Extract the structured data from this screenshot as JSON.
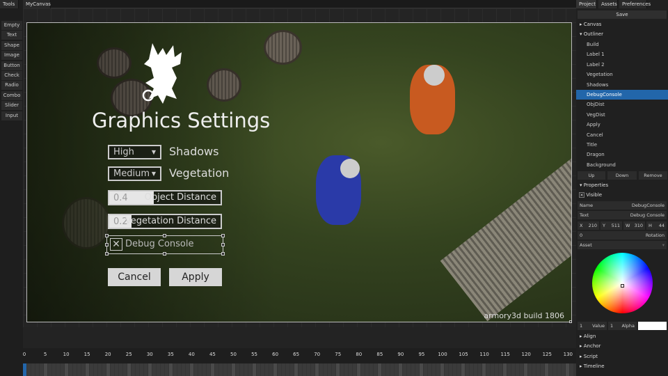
{
  "tabs": {
    "tools": "Tools",
    "canvas": "MyCanvas"
  },
  "tools": [
    "Empty",
    "Text",
    "Shape",
    "Image",
    "Button",
    "Check",
    "Radio",
    "Combo",
    "Slider",
    "Input"
  ],
  "scene": {
    "title": "Graphics Settings",
    "shadows": {
      "value": "High",
      "label": "Shadows"
    },
    "vegetation": {
      "value": "Medium",
      "label": "Vegetation"
    },
    "object_distance": {
      "value": "0.4",
      "label": "Object Distance",
      "fraction": 0.4
    },
    "vegetation_distance": {
      "value": "0.2",
      "label": "Vegetation Distance",
      "fraction": 0.2
    },
    "debug_console": {
      "label": "Debug Console",
      "checked": true
    },
    "cancel": "Cancel",
    "apply": "Apply",
    "build": "armory3d build 1806"
  },
  "right_panel": {
    "tabs": [
      "Project",
      "Assets",
      "Preferences"
    ],
    "save": "Save",
    "canvas_section": "Canvas",
    "outliner_section": "Outliner",
    "outliner": [
      "Build",
      "Label 1",
      "Label 2",
      "Vegetation",
      "Shadows",
      "DebugConsole",
      "ObjDist",
      "VegDist",
      "Apply",
      "Cancel",
      "Title",
      "Dragon",
      "Background"
    ],
    "selected": "DebugConsole",
    "up": "Up",
    "down": "Down",
    "remove": "Remove",
    "properties_section": "Properties",
    "visible": "Visible",
    "name_label": "Name",
    "name_value": "DebugConsole",
    "text_label": "Text",
    "text_value": "Debug Console",
    "x_label": "X",
    "x": "210",
    "y_label": "Y",
    "y": "511",
    "w_label": "W",
    "w": "310",
    "h_label": "H",
    "h": "44",
    "rotation_value": "0",
    "rotation_label": "Rotation",
    "asset_label": "Asset",
    "value_num": "1",
    "value_label": "Value",
    "alpha_num": "1",
    "alpha_label": "Alpha",
    "swatch_color": "#ffffff",
    "collapsed": [
      "Align",
      "Anchor",
      "Script",
      "Timeline"
    ]
  },
  "timeline": {
    "ticks": [
      "0",
      "5",
      "10",
      "15",
      "20",
      "25",
      "30",
      "35",
      "40",
      "45",
      "50",
      "55",
      "60",
      "65",
      "70",
      "75",
      "80",
      "85",
      "90",
      "95",
      "100",
      "105",
      "110",
      "115",
      "120",
      "125",
      "130"
    ],
    "current_frame": 0
  },
  "colors": {
    "accent": "#2266aa"
  }
}
